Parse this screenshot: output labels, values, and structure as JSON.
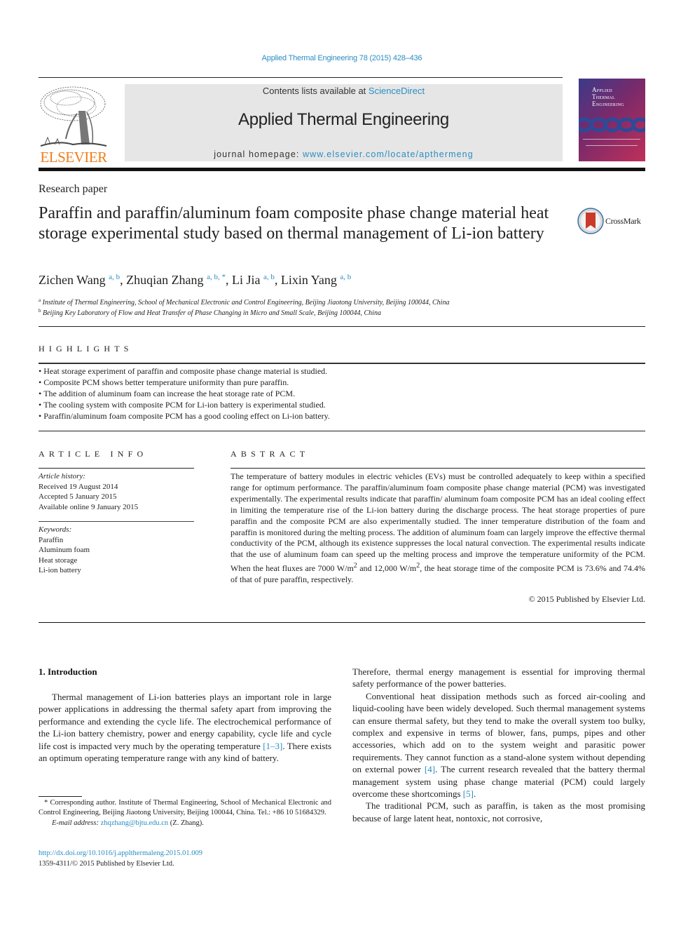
{
  "header": {
    "journal_ref": "Applied Thermal Engineering 78 (2015) 428–436",
    "contents_prefix": "Contents lists available at ",
    "contents_link": "ScienceDirect",
    "journal_title": "Applied Thermal Engineering",
    "homepage_prefix": "journal homepage: ",
    "homepage_link": "www.elsevier.com/locate/apthermeng",
    "publisher_logo_text": "ELSEVIER",
    "cover_title": [
      "Applied",
      "Thermal",
      "Engineering"
    ],
    "publisher_color": "#f07d1a",
    "link_color": "#2a8dc3"
  },
  "article": {
    "type": "Research paper",
    "title": "Paraffin and paraffin/aluminum foam composite phase change material heat storage experimental study based on thermal management of Li-ion battery",
    "crossmark_label": "CrossMark",
    "authors": [
      {
        "name": "Zichen Wang",
        "affil": "a, b"
      },
      {
        "name": "Zhuqian Zhang",
        "affil": "a, b, *"
      },
      {
        "name": "Li Jia",
        "affil": "a, b"
      },
      {
        "name": "Lixin Yang",
        "affil": "a, b"
      }
    ],
    "affiliations": [
      {
        "mark": "a",
        "text": "Institute of Thermal Engineering, School of Mechanical Electronic and Control Engineering, Beijing Jiaotong University, Beijing 100044, China"
      },
      {
        "mark": "b",
        "text": "Beijing Key Laboratory of Flow and Heat Transfer of Phase Changing in Micro and Small Scale, Beijing 100044, China"
      }
    ]
  },
  "highlights": {
    "heading": "HIGHLIGHTS",
    "items": [
      "Heat storage experiment of paraffin and composite phase change material is studied.",
      "Composite PCM shows better temperature uniformity than pure paraffin.",
      "The addition of aluminum foam can increase the heat storage rate of PCM.",
      "The cooling system with composite PCM for Li-ion battery is experimental studied.",
      "Paraffin/aluminum foam composite PCM has a good cooling effect on Li-ion battery."
    ]
  },
  "article_info": {
    "heading": "ARTICLE INFO",
    "history_label": "Article history:",
    "history": [
      "Received 19 August 2014",
      "Accepted 5 January 2015",
      "Available online 9 January 2015"
    ],
    "keywords_label": "Keywords:",
    "keywords": [
      "Paraffin",
      "Aluminum foam",
      "Heat storage",
      "Li-ion battery"
    ]
  },
  "abstract": {
    "heading": "ABSTRACT",
    "text_part1": "The temperature of battery modules in electric vehicles (EVs) must be controlled adequately to keep within a specified range for optimum performance. The paraffin/aluminum foam composite phase change material (PCM) was investigated experimentally. The experimental results indicate that paraffin/ aluminum foam composite PCM has an ideal cooling effect in limiting the temperature rise of the Li-ion battery during the discharge process. The heat storage properties of pure paraffin and the composite PCM are also experimentally studied. The inner temperature distribution of the foam and paraffin is moni­tored during the melting process. The addition of aluminum foam can largely improve the effective thermal conductivity of the PCM, although its existence suppresses the local natural convection. The experimental results indicate that the use of aluminum foam can speed up the melting process and improve the temperature uniformity of the PCM. When the heat fluxes are 7000 W/m",
    "sup1": "2",
    "text_part2": " and 12,000 W/m",
    "sup2": "2",
    "text_part3": ", the heat storage time of the composite PCM is 73.6% and 74.4% of that of pure paraffin, respectively.",
    "copyright": "© 2015 Published by Elsevier Ltd."
  },
  "body": {
    "section_heading": "1.  Introduction",
    "left_paragraph": {
      "before_ref": "Thermal management of Li-ion batteries plays an important role in large power applications in addressing the thermal safety apart from improving the performance and extending the cycle life. The electrochemical performance of the Li-ion battery chemistry, po­wer and energy capability, cycle life and cycle life cost is impacted very much by the operating temperature ",
      "ref": "[1–3]",
      "after_ref": ". There exists an optimum operating temperature range with any kind of battery."
    },
    "right_paragraphs": {
      "p1": "Therefore, thermal energy management is essential for improving thermal safety performance of the power batteries.",
      "p2_a": "Conventional heat dissipation methods such as forced air-cooling and liquid-cooling have been widely developed. Such thermal management systems can ensure thermal safety, but they tend to make the overall system too bulky, complex and expensive in terms of blower, fans, pumps, pipes and other accessories, which add on to the system weight and parasitic power requirements. They cannot function as a stand-alone system without depending on external power ",
      "p2_ref1": "[4]",
      "p2_b": ". The current research revealed that the bat­tery thermal management system using phase change material (PCM) could largely overcome these shortcomings ",
      "p2_ref2": "[5]",
      "p2_c": ".",
      "p3": "The traditional PCM, such as paraffin, is taken as the most promising because of large latent heat, nontoxic, not corrosive,"
    }
  },
  "footnote": {
    "corresponding": "* Corresponding author. Institute of Thermal Engineering, School of Mechanical Electronic and Control Engineering, Beijing Jiaotong University, Beijing 100044, China. Tel.: +86 10 51684329.",
    "email_label": "E-mail address: ",
    "email": "zhqzhang@bjtu.edu.cn",
    "email_suffix": " (Z. Zhang).",
    "doi": "http://dx.doi.org/10.1016/j.applthermaleng.2015.01.009",
    "issn": "1359-4311/© 2015 Published by Elsevier Ltd."
  }
}
